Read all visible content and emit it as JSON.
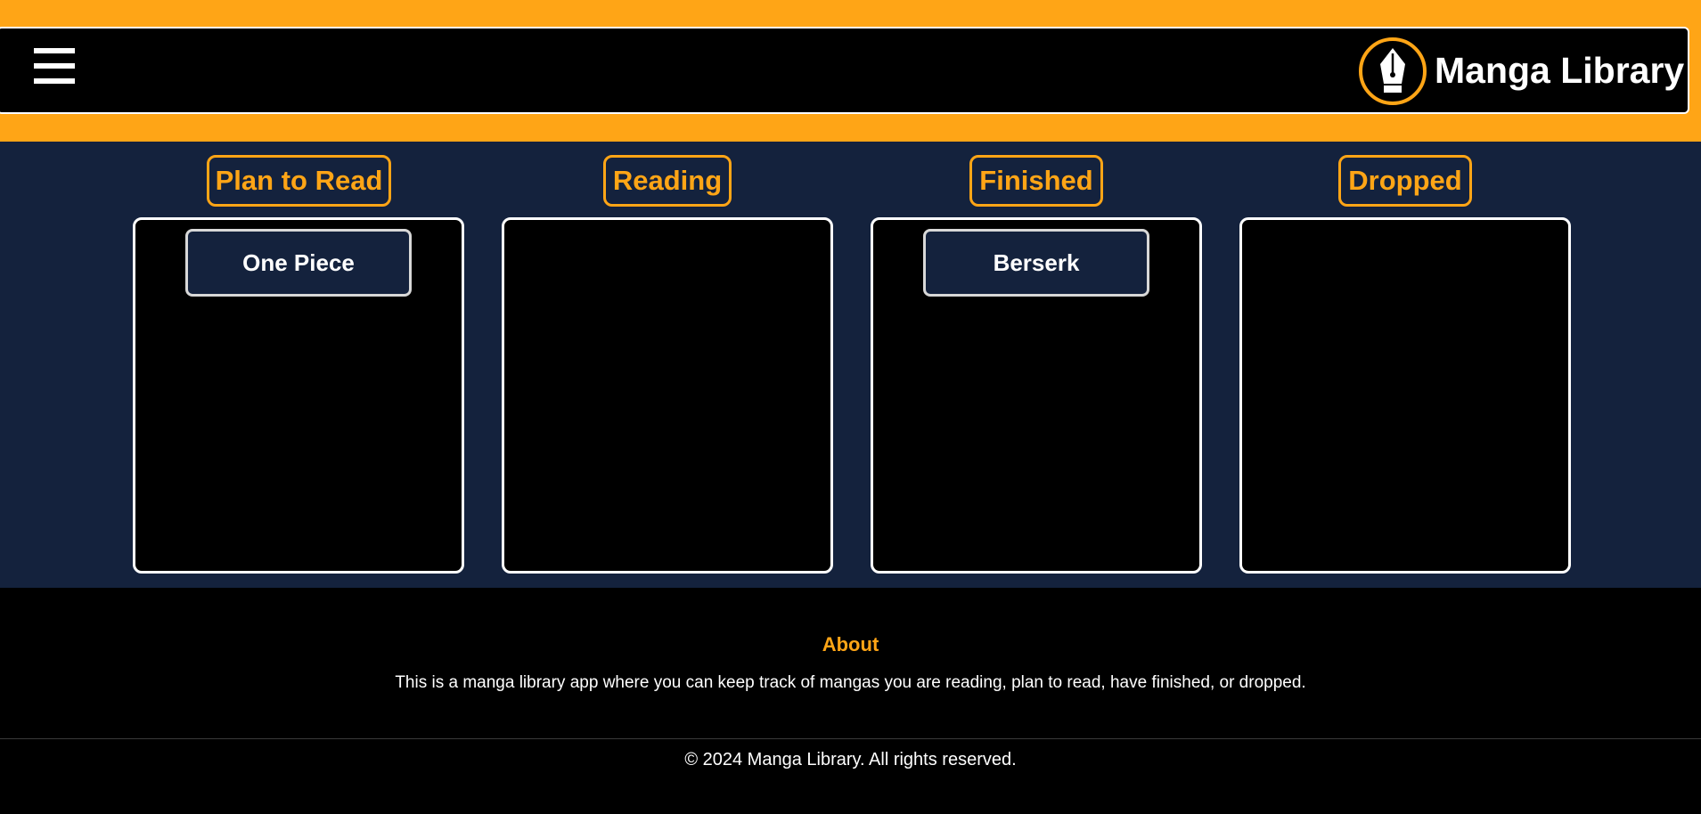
{
  "header": {
    "menu_icon": "hamburger-menu-icon",
    "logo_icon": "pen-nib-icon",
    "brand": "Manga Library"
  },
  "columns": [
    {
      "title": "Plan to Read",
      "items": [
        "One Piece"
      ]
    },
    {
      "title": "Reading",
      "items": []
    },
    {
      "title": "Finished",
      "items": [
        "Berserk"
      ]
    },
    {
      "title": "Dropped",
      "items": []
    }
  ],
  "footer": {
    "about_title": "About",
    "about_text": "This is a manga library app where you can keep track of mangas you are reading, plan to read, have finished, or dropped.",
    "copyright": "© 2024 Manga Library. All rights reserved."
  },
  "colors": {
    "accent": "#ffa516",
    "board_bg": "#14223d",
    "header_bg": "#000000",
    "text": "#ffffff"
  }
}
